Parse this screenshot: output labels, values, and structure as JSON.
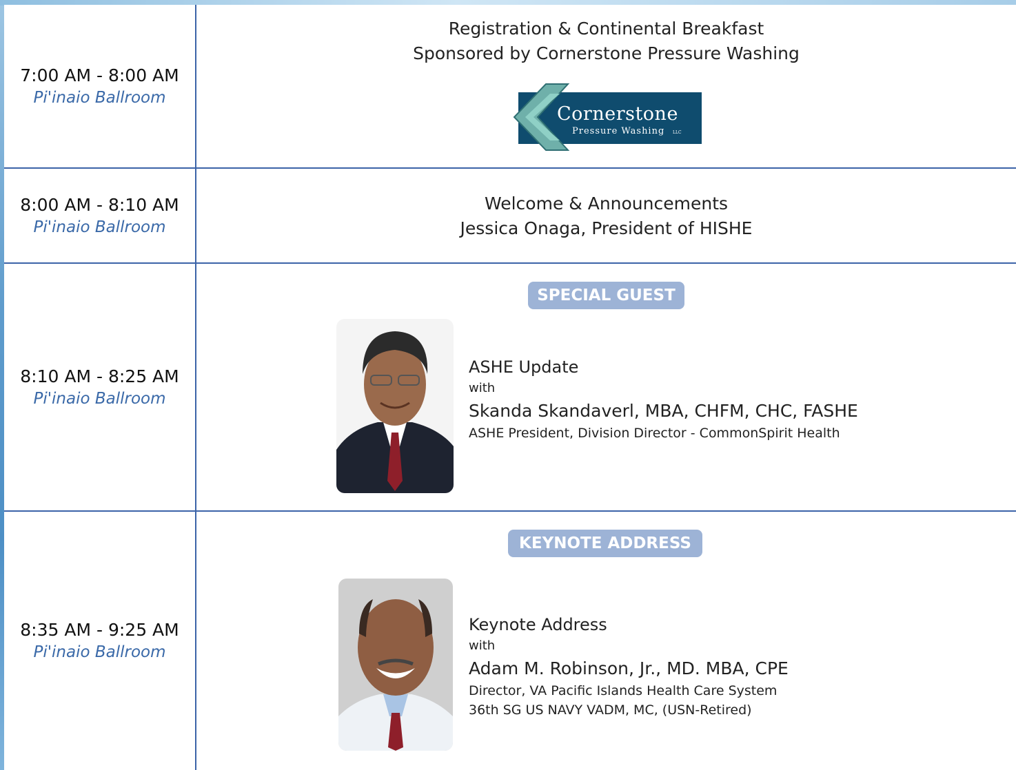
{
  "rows": [
    {
      "time": "7:00 AM - 8:00 AM",
      "location": "Pi'inaio Ballroom",
      "line1": "Registration & Continental Breakfast",
      "line2": "Sponsored by Cornerstone Pressure Washing",
      "logo": {
        "name": "Cornerstone",
        "tagline": "Pressure Washing",
        "suffix": "LLC"
      }
    },
    {
      "time": "8:00 AM - 8:10 AM",
      "location": "Pi'inaio Ballroom",
      "line1": "Welcome & Announcements",
      "line2": "Jessica Onaga, President of HISHE"
    },
    {
      "time": "8:10 AM - 8:25 AM",
      "location": "Pi'inaio Ballroom",
      "badge": "SPECIAL GUEST",
      "topic": "ASHE Update",
      "with": "with",
      "speaker": "Skanda Skandaverl, MBA, CHFM, CHC, FASHE",
      "title1": "ASHE President, Division Director - CommonSpirit Health"
    },
    {
      "time": "8:35 AM - 9:25 AM",
      "location": "Pi'inaio Ballroom",
      "badge": "KEYNOTE ADDRESS",
      "topic": "Keynote Address",
      "with": "with",
      "speaker": "Adam M. Robinson, Jr., MD. MBA, CPE",
      "title1": "Director, VA Pacific Islands Health Care System",
      "title2": "36th SG US NAVY VADM, MC, (USN-Retired)"
    }
  ]
}
